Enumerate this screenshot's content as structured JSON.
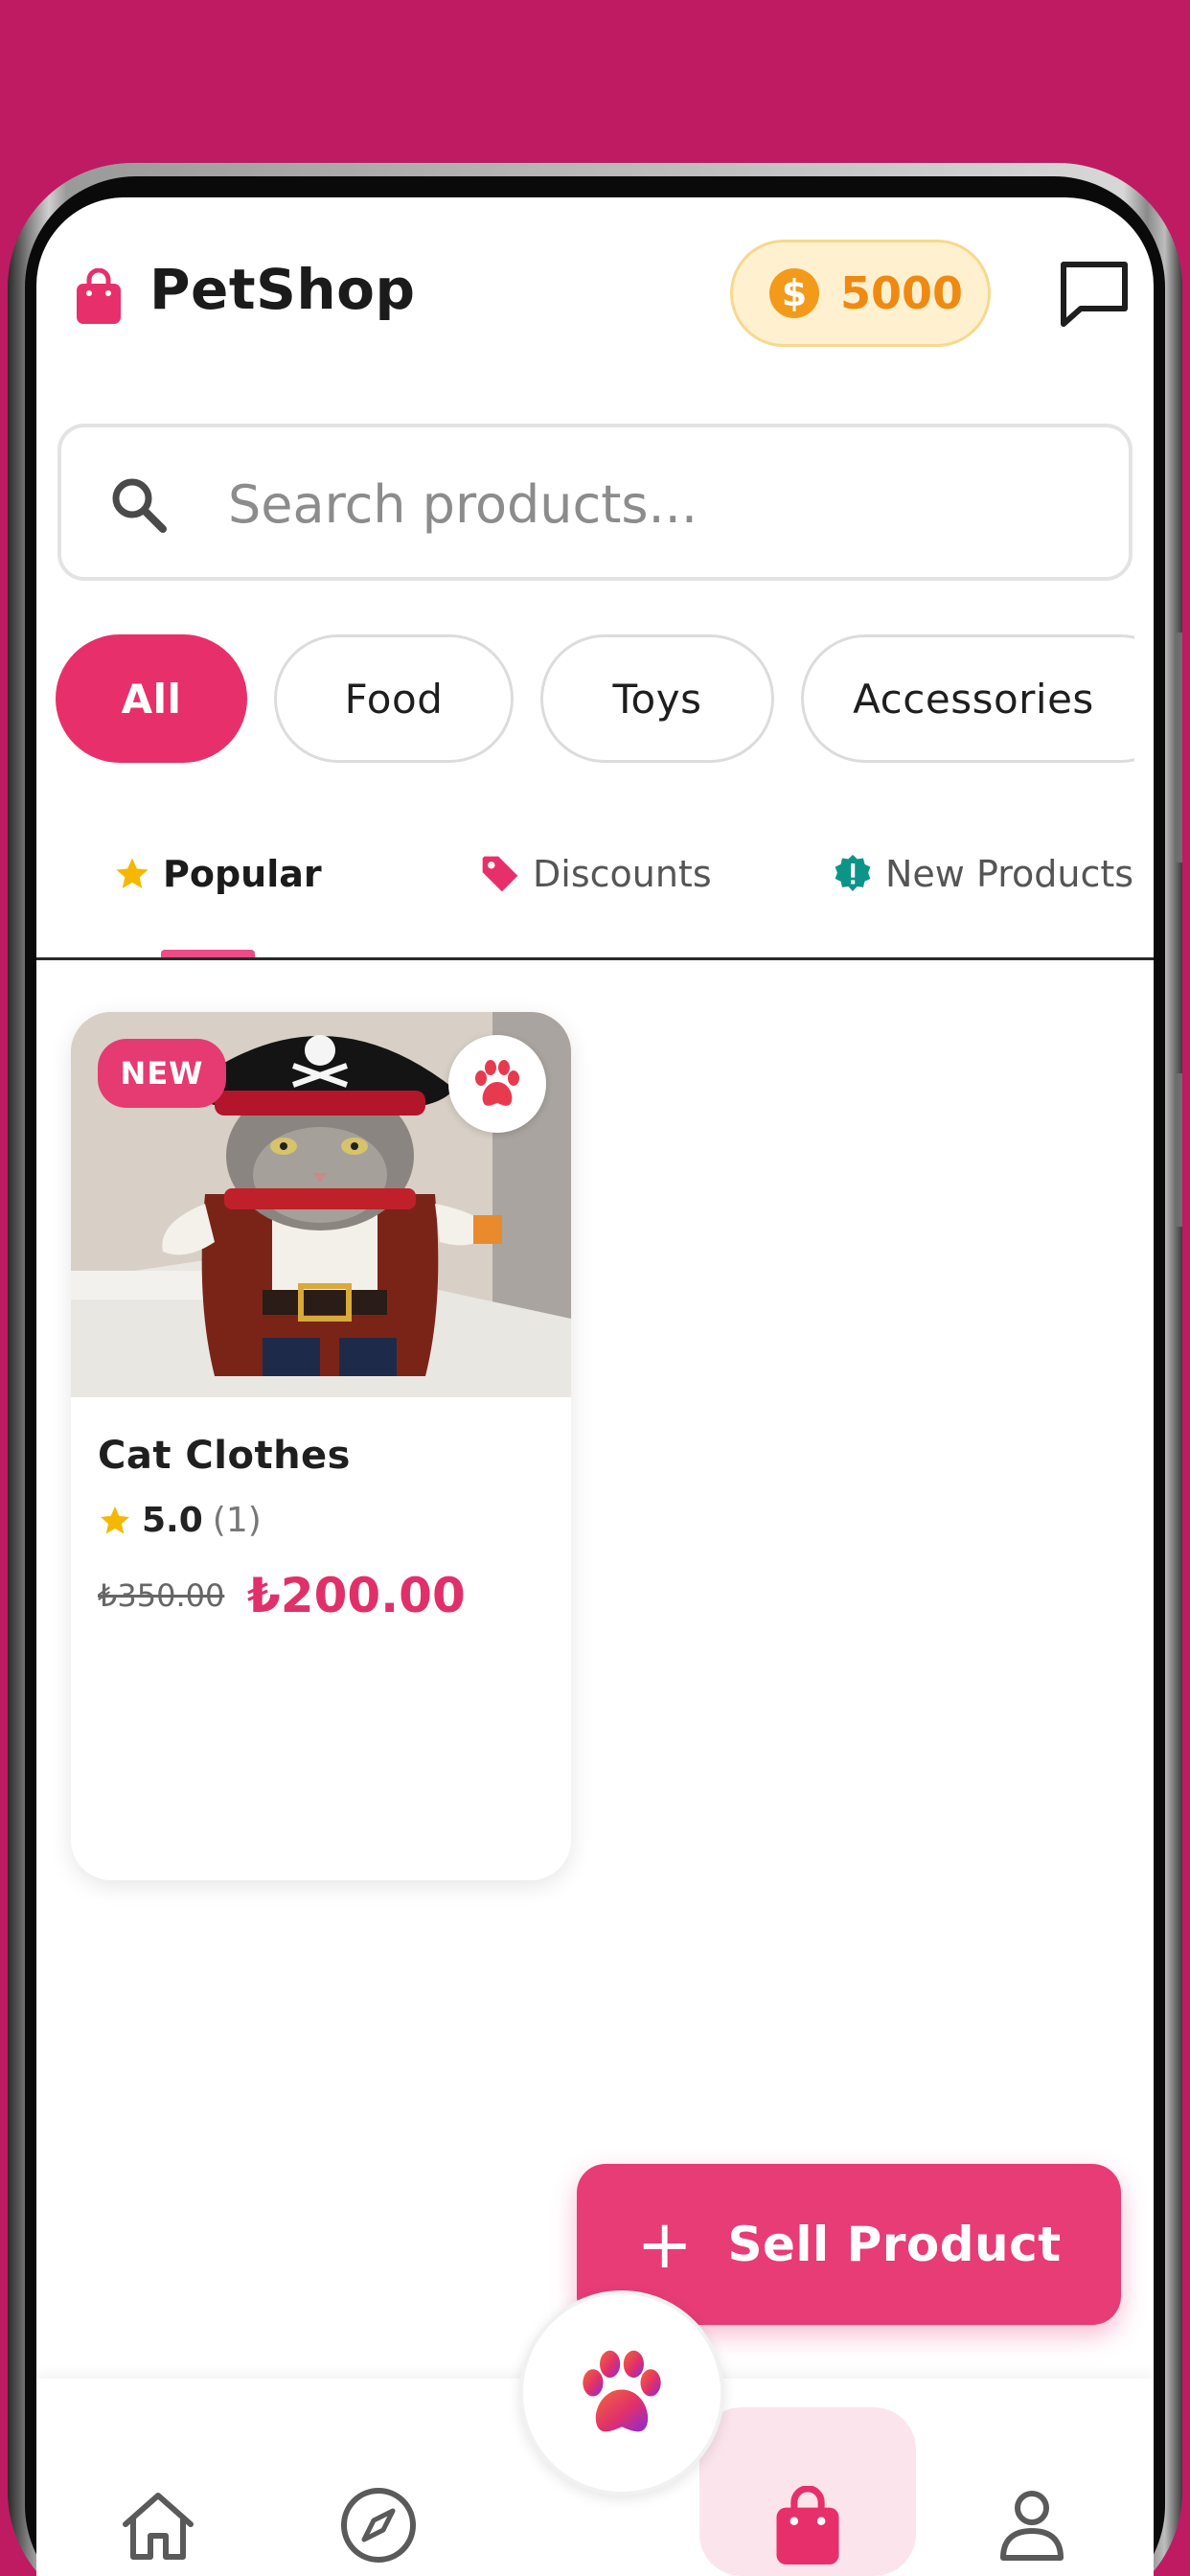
{
  "header": {
    "brand_name": "PetShop",
    "coin_symbol": "$",
    "coin_balance": "5000"
  },
  "search": {
    "placeholder": "Search products..."
  },
  "categories": [
    {
      "label": "All",
      "active": true
    },
    {
      "label": "Food",
      "active": false
    },
    {
      "label": "Toys",
      "active": false
    },
    {
      "label": "Accessories",
      "active": false
    }
  ],
  "tabs": [
    {
      "label": "Popular",
      "icon": "star-icon",
      "active": true
    },
    {
      "label": "Discounts",
      "icon": "tag-icon",
      "active": false
    },
    {
      "label": "New Products",
      "icon": "alert-badge-icon",
      "active": false
    }
  ],
  "products": [
    {
      "badge": "NEW",
      "name": "Cat Clothes",
      "rating": "5.0",
      "review_count": "(1)",
      "old_price": "₺350.00",
      "price": "₺200.00"
    }
  ],
  "fab": {
    "sell_label": "Sell Product"
  },
  "bottom_nav": {
    "items": [
      "home-icon",
      "compass-icon",
      "paw-icon",
      "shopping-bag-icon",
      "profile-icon"
    ],
    "active": "shopping-bag-icon"
  },
  "colors": {
    "background": "#be1b63",
    "accent": "#e7306b",
    "coin": "#f39a1b",
    "chat_green": "#3dba5a"
  }
}
